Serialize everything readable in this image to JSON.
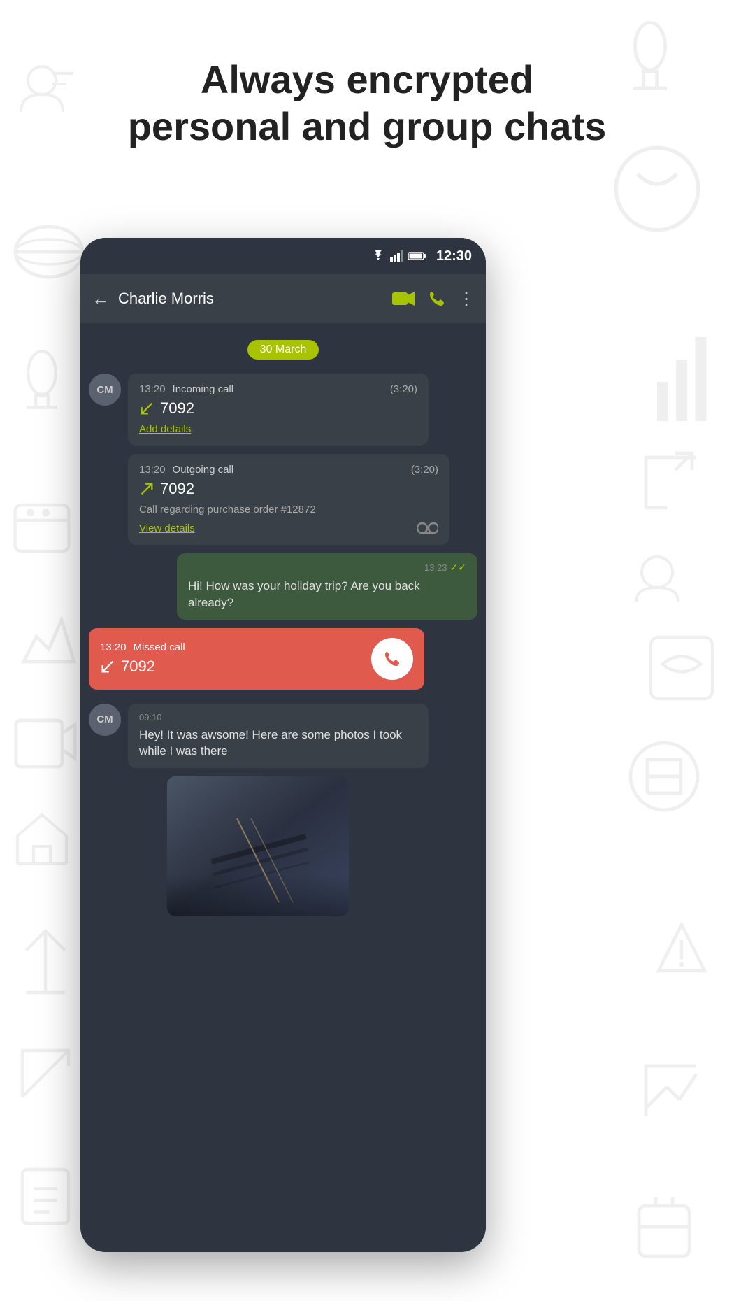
{
  "header": {
    "line1": "Always encrypted",
    "line2": "personal and group chats"
  },
  "status_bar": {
    "time": "12:30"
  },
  "app_bar": {
    "title": "Charlie Morris",
    "back_label": "←",
    "video_icon": "📹",
    "phone_icon": "📞",
    "more_icon": "⋮"
  },
  "chat": {
    "date_badge": "30 March",
    "messages": [
      {
        "type": "incoming_call",
        "avatar": "CM",
        "time": "13:20",
        "call_type": "Incoming call",
        "duration": "(3:20)",
        "number": "7092",
        "action_label": "Add details"
      },
      {
        "type": "outgoing_call",
        "time": "13:20",
        "call_type": "Outgoing call",
        "duration": "(3:20)",
        "number": "7092",
        "note": "Call regarding purchase order #12872",
        "action_label": "View details"
      },
      {
        "type": "text_own",
        "time": "13:23",
        "text": "Hi! How was your holiday trip? Are you back already?",
        "double_check": "✓✓"
      },
      {
        "type": "missed_call",
        "time": "13:20",
        "call_type": "Missed call",
        "number": "7092"
      },
      {
        "type": "incoming_text",
        "avatar": "CM",
        "time": "09:10",
        "text": "Hey! It was awsome! Here are some photos I took while I was there"
      },
      {
        "type": "incoming_photo",
        "avatar": "CM"
      }
    ]
  }
}
